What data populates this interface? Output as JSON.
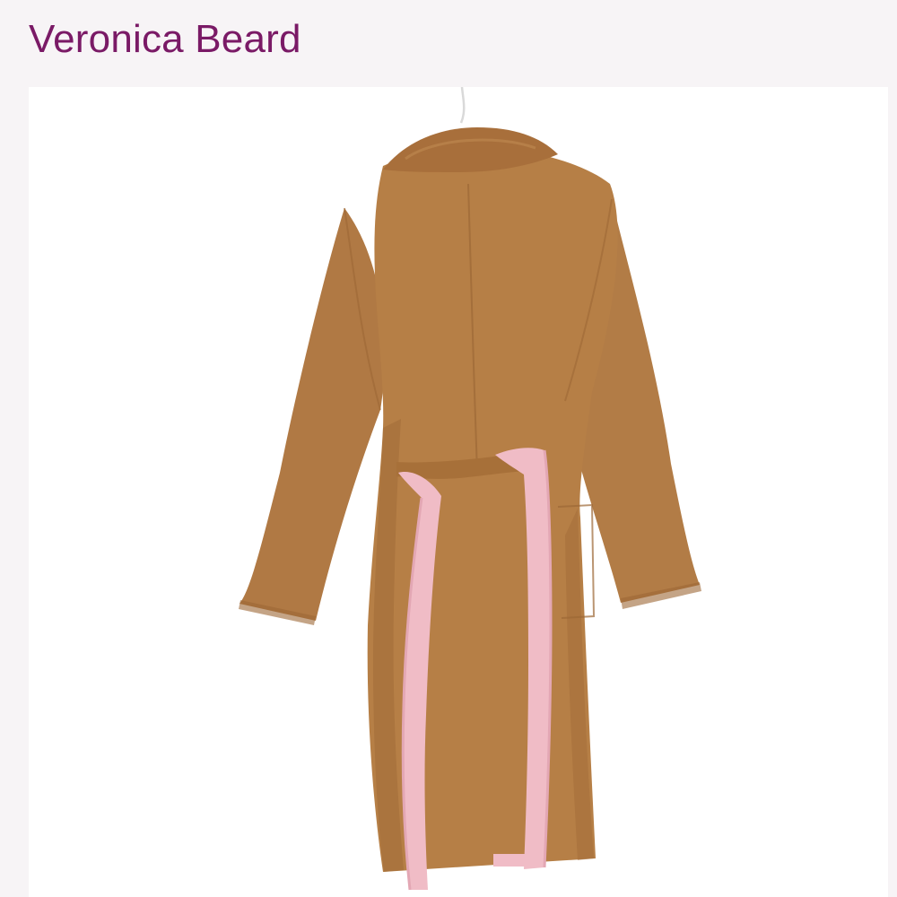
{
  "header": {
    "brand_name": "Veronica Beard"
  },
  "photo": {
    "subject": "coat-back-view",
    "colors": {
      "background": "#ffffff",
      "coat": "#b67f46",
      "coat_shadow": "#9c6836",
      "coat_highlight": "#c38b52",
      "belt": "#f0bcc6",
      "belt_shadow": "#e3a7b4",
      "hanger": "#d9d9d9"
    }
  },
  "theme": {
    "page_background": "#f7f4f6",
    "brand_color": "#7a1a66"
  }
}
